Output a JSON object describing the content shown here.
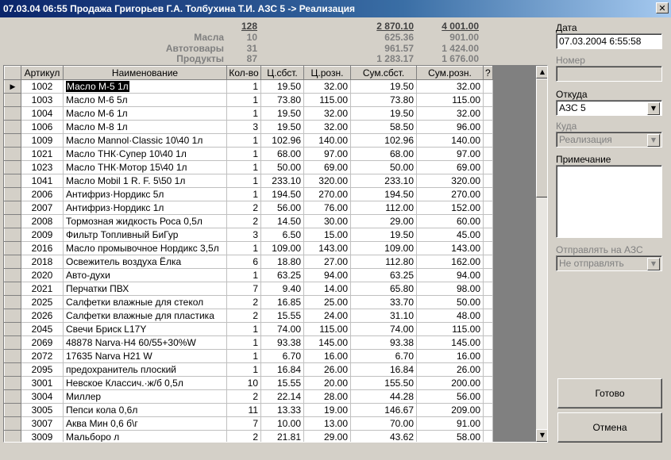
{
  "window": {
    "title": "07.03.04 06:55  Продажа Григорьев Г.А. Толбухина Т.И.    АЗС 5 -> Реализация"
  },
  "summary": {
    "total_qty": "128",
    "total_cost": "2 870.10",
    "total_retail": "4 001.00",
    "rows": [
      {
        "label": "Масла",
        "qty": "10",
        "cost": "625.36",
        "retail": "901.00"
      },
      {
        "label": "Автотовары",
        "qty": "31",
        "cost": "961.57",
        "retail": "1 424.00"
      },
      {
        "label": "Продукты",
        "qty": "87",
        "cost": "1 283.17",
        "retail": "1 676.00"
      }
    ]
  },
  "grid": {
    "columns": [
      "Артикул",
      "Наименование",
      "Кол-во",
      "Ц.сбст.",
      "Ц.розн.",
      "Сум.сбст.",
      "Сум.розн.",
      "?"
    ],
    "current_row_marker": "▶",
    "rows": [
      [
        "1002",
        "Масло  М-5  1л",
        "1",
        "19.50",
        "32.00",
        "19.50",
        "32.00"
      ],
      [
        "1003",
        "Масло  М-6  5л",
        "1",
        "73.80",
        "115.00",
        "73.80",
        "115.00"
      ],
      [
        "1004",
        "Масло  М-6  1л",
        "1",
        "19.50",
        "32.00",
        "19.50",
        "32.00"
      ],
      [
        "1006",
        "Масло  М-8  1л",
        "3",
        "19.50",
        "32.00",
        "58.50",
        "96.00"
      ],
      [
        "1009",
        "Масло Mannol·Classic 10\\40 1л",
        "1",
        "102.96",
        "140.00",
        "102.96",
        "140.00"
      ],
      [
        "1021",
        "Масло ТНК·Супер 10\\40 1л",
        "1",
        "68.00",
        "97.00",
        "68.00",
        "97.00"
      ],
      [
        "1023",
        "Масло ТНК·Мотор 15\\40 1л",
        "1",
        "50.00",
        "69.00",
        "50.00",
        "69.00"
      ],
      [
        "1041",
        "Масло Mobil 1 R. F. 5\\50 1л",
        "1",
        "233.10",
        "320.00",
        "233.10",
        "320.00"
      ],
      [
        "2006",
        "Антифриз·Нордикс  5л",
        "1",
        "194.50",
        "270.00",
        "194.50",
        "270.00"
      ],
      [
        "2007",
        "Антифриз·Нордикс  1л",
        "2",
        "56.00",
        "76.00",
        "112.00",
        "152.00"
      ],
      [
        "2008",
        "Тормозная жидкость Роса  0,5л",
        "2",
        "14.50",
        "30.00",
        "29.00",
        "60.00"
      ],
      [
        "2009",
        "Фильтр Топливный  БиГур",
        "3",
        "6.50",
        "15.00",
        "19.50",
        "45.00"
      ],
      [
        "2016",
        "Масло промывочное Нордикс 3,5л",
        "1",
        "109.00",
        "143.00",
        "109.00",
        "143.00"
      ],
      [
        "2018",
        "Освежитель воздуха  Ёлка",
        "6",
        "18.80",
        "27.00",
        "112.80",
        "162.00"
      ],
      [
        "2020",
        "Авто-духи",
        "1",
        "63.25",
        "94.00",
        "63.25",
        "94.00"
      ],
      [
        "2021",
        "Перчатки ПВХ",
        "7",
        "9.40",
        "14.00",
        "65.80",
        "98.00"
      ],
      [
        "2025",
        "Салфетки влажные  для стекол",
        "2",
        "16.85",
        "25.00",
        "33.70",
        "50.00"
      ],
      [
        "2026",
        "Салфетки влажные  для пластика",
        "2",
        "15.55",
        "24.00",
        "31.10",
        "48.00"
      ],
      [
        "2045",
        "Свечи Бриск L17Y",
        "1",
        "74.00",
        "115.00",
        "74.00",
        "115.00"
      ],
      [
        "2069",
        "48878 Narva·H4 60/55+30%W",
        "1",
        "93.38",
        "145.00",
        "93.38",
        "145.00"
      ],
      [
        "2072",
        "17635 Narva H21 W",
        "1",
        "6.70",
        "16.00",
        "6.70",
        "16.00"
      ],
      [
        "2095",
        "предохранитель  плоский",
        "1",
        "16.84",
        "26.00",
        "16.84",
        "26.00"
      ],
      [
        "3001",
        "Невское Классич.·ж/б 0,5л",
        "10",
        "15.55",
        "20.00",
        "155.50",
        "200.00"
      ],
      [
        "3004",
        "Миллер",
        "2",
        "22.14",
        "28.00",
        "44.28",
        "56.00"
      ],
      [
        "3005",
        "Пепси кола 0,6л",
        "11",
        "13.33",
        "19.00",
        "146.67",
        "209.00"
      ],
      [
        "3007",
        "Аква Мин 0,6 б\\г",
        "7",
        "10.00",
        "13.00",
        "70.00",
        "91.00"
      ],
      [
        "3009",
        "Мальборо л",
        "2",
        "21.81",
        "29.00",
        "43.62",
        "58.00"
      ]
    ]
  },
  "form": {
    "date_label": "Дата",
    "date_value": "07.03.2004 6:55:58",
    "number_label": "Номер",
    "number_value": "",
    "from_label": "Откуда",
    "from_value": "АЗС 5",
    "to_label": "Куда",
    "to_value": "Реализация",
    "note_label": "Примечание",
    "note_value": "",
    "send_label": "Отправлять на АЗС",
    "send_value": "Не отправлять"
  },
  "buttons": {
    "done": "Готово",
    "cancel": "Отмена"
  },
  "icons": {
    "close": "close-icon",
    "dropdown": "chevron-down-icon",
    "row_pointer": "row-pointer-icon"
  }
}
